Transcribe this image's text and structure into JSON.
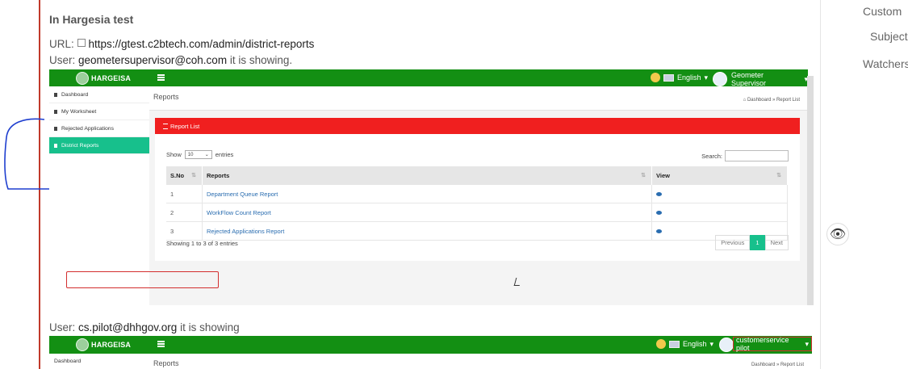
{
  "issue": {
    "heading": "In Hargesia test",
    "url_label": "URL:",
    "url": "https://gtest.c2btech.com/admin/district-reports",
    "user1_prefix": "User:",
    "user1_email": "geometersupervisor@coh.com",
    "user1_suffix": "it is showing.",
    "user2_prefix": "User:",
    "user2_email": "cs.pilot@dhhgov.org",
    "user2_suffix": "it is showing"
  },
  "app": {
    "logo_text": "HARGEISA",
    "language": "English",
    "user_name": "Geometer Supervisor",
    "user2_name": "customerservice pilot",
    "sidebar": [
      {
        "label": "Dashboard",
        "active": false
      },
      {
        "label": "My Worksheet",
        "active": false
      },
      {
        "label": "Rejected Applications",
        "active": false
      },
      {
        "label": "District Reports",
        "active": true
      }
    ],
    "page_title": "Reports",
    "breadcrumb": "Dashboard  »  Report List",
    "panel_title": "Report List",
    "show_label": "Show",
    "entries_value": "10",
    "entries_label": "entries",
    "search_label": "Search:",
    "columns": [
      "S.No",
      "Reports",
      "View"
    ],
    "rows": [
      {
        "no": "1",
        "report": "Department Queue Report"
      },
      {
        "no": "2",
        "report": "WorkFlow Count Report"
      },
      {
        "no": "3",
        "report": "Rejected Applications Report"
      }
    ],
    "showing": "Showing 1 to 3 of 3 entries",
    "pager": {
      "prev": "Previous",
      "page": "1",
      "next": "Next"
    }
  },
  "right_panel": {
    "custom": "Custom",
    "subject": "Subject",
    "watchers": "Watchers"
  }
}
